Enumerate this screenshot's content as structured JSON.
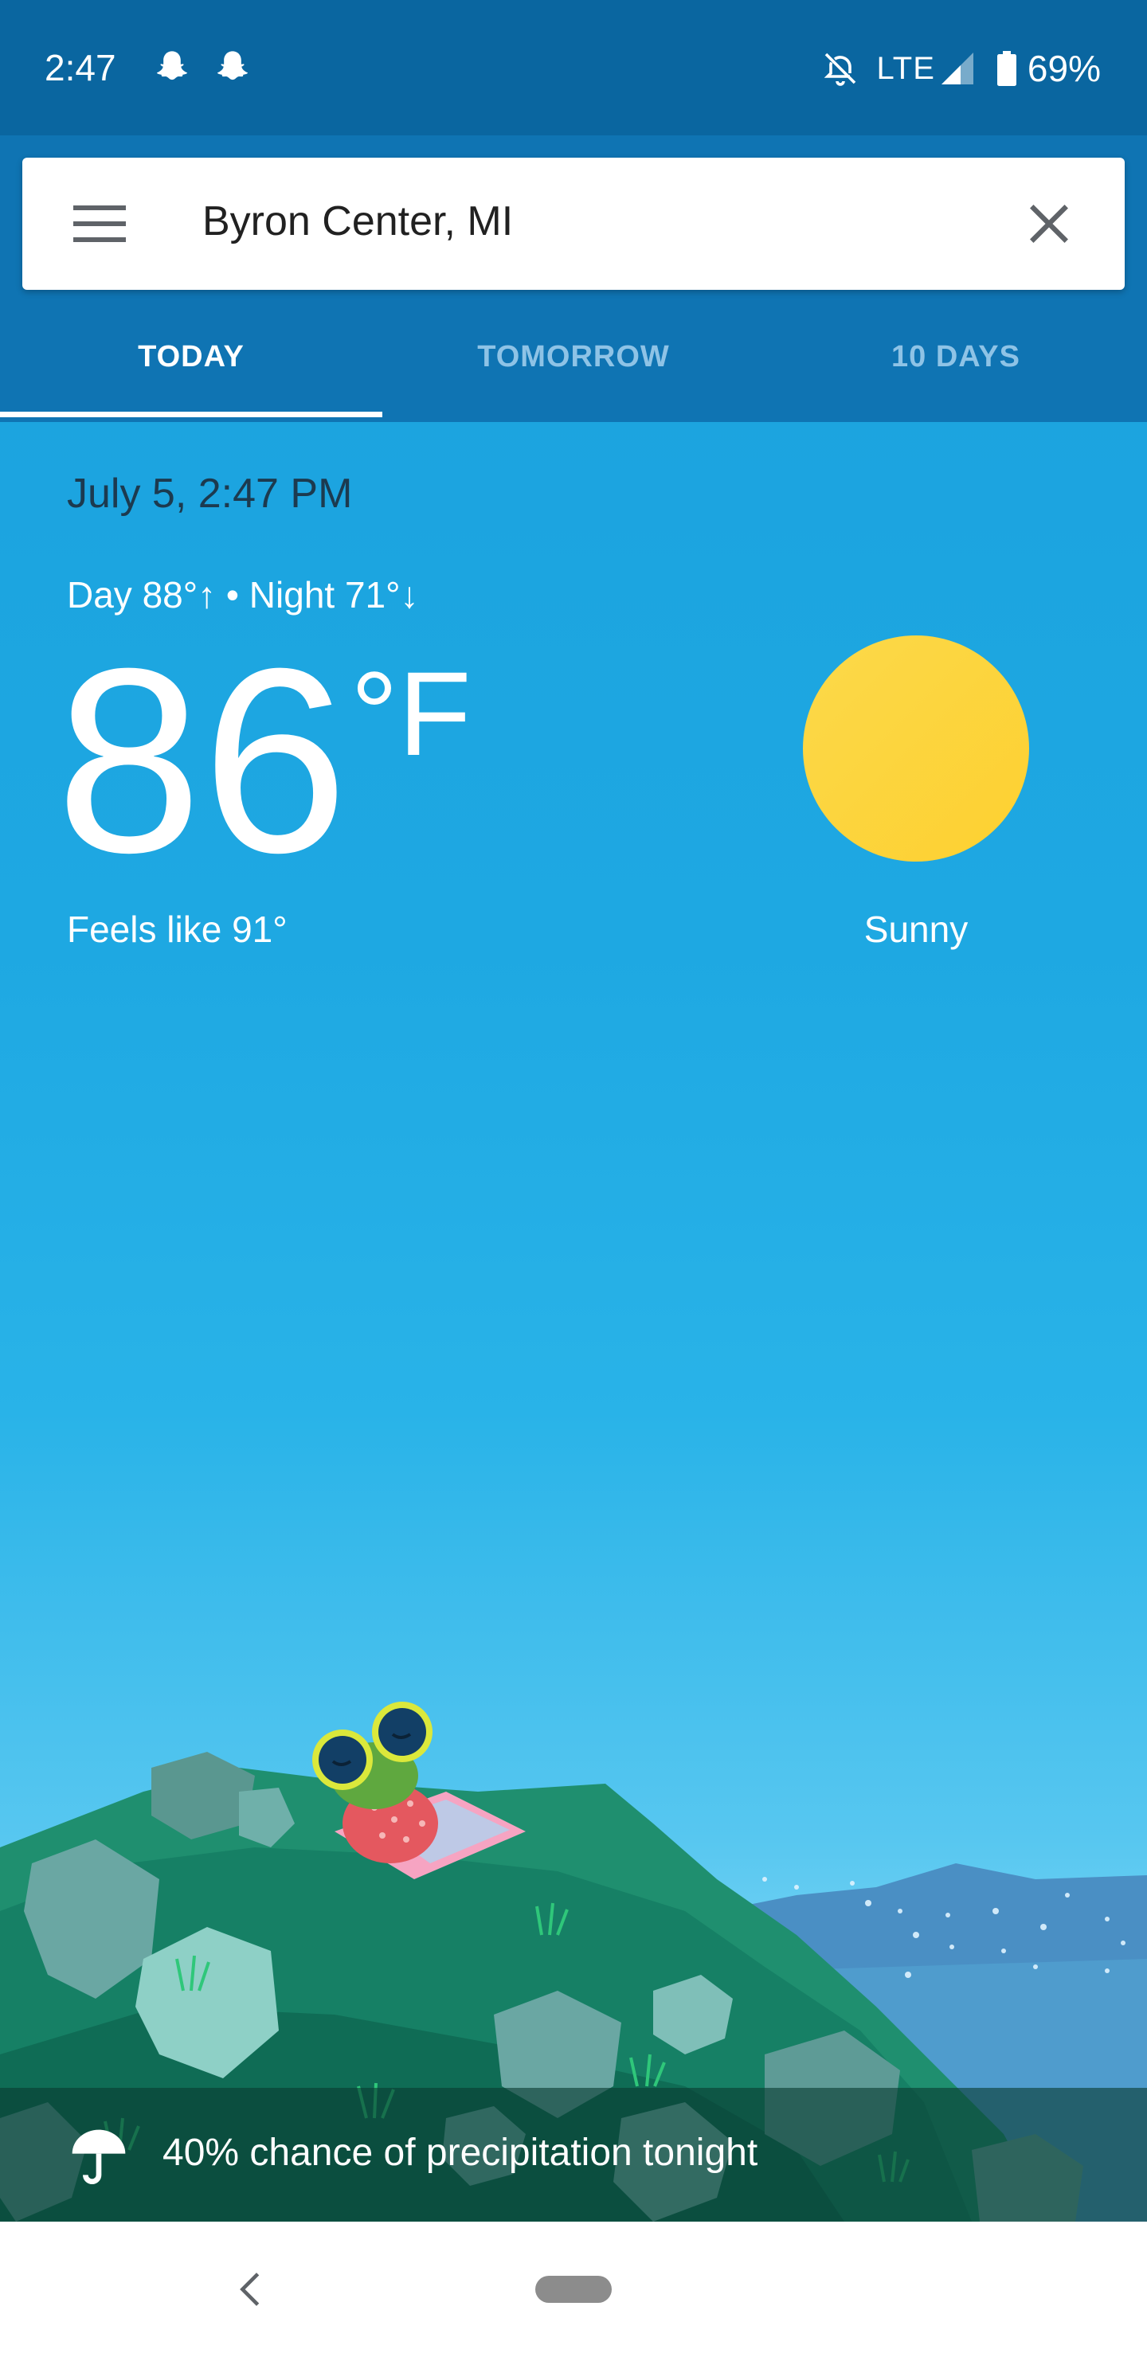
{
  "status_bar": {
    "time": "2:47",
    "network": "LTE",
    "battery": "69%",
    "icons": [
      "snapchat-icon",
      "snapchat-icon",
      "notifications-off-icon",
      "signal-icon",
      "battery-icon"
    ]
  },
  "search": {
    "location": "Byron Center, MI",
    "icons": [
      "menu-icon",
      "close-icon"
    ]
  },
  "tabs": [
    {
      "label": "TODAY",
      "active": true
    },
    {
      "label": "TOMORROW",
      "active": false
    },
    {
      "label": "10 DAYS",
      "active": false
    }
  ],
  "weather": {
    "datetime": "July 5, 2:47 PM",
    "day_night": "Day 88°↑ • Night 71°↓",
    "temperature": "86",
    "unit": "°F",
    "feels_like": "Feels like 91°",
    "condition": "Sunny",
    "condition_icon": "sun-icon"
  },
  "precipitation": {
    "text": "40% chance of precipitation tonight",
    "icon": "umbrella-icon"
  },
  "colors": {
    "status_bar": "#0a66a0",
    "header": "#0f74b3",
    "sky": "#1ea8e2",
    "sun": "#fdd835"
  }
}
